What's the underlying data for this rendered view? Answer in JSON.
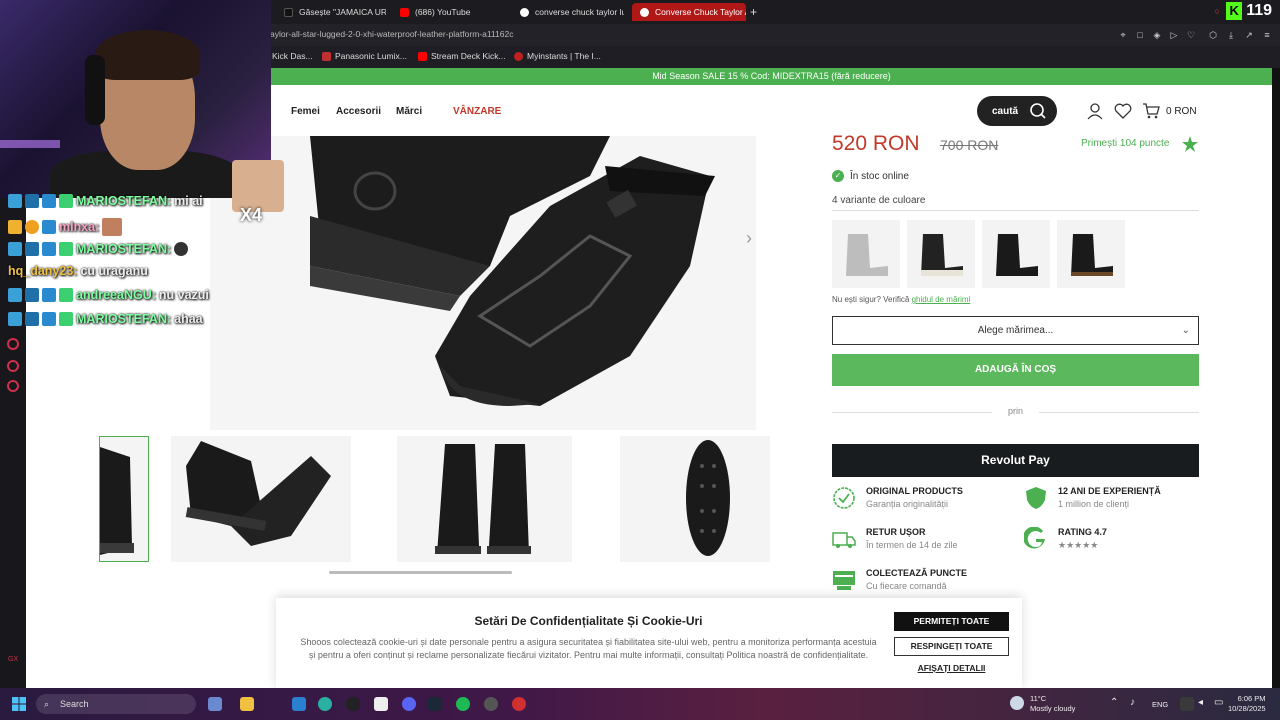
{
  "browser": {
    "tabs": [
      {
        "label": "Găsește \"JAMAICA URAG",
        "color": "#111111"
      },
      {
        "label": "(686) YouTube",
        "color": "#ff0000"
      },
      {
        "label": "converse chuck taylor lug",
        "color": "#ffffff"
      },
      {
        "label": "Converse Chuck Taylor A",
        "color": "#ffffff"
      }
    ],
    "url": "aylor-all-star-lugged-2-0-xhi-waterproof-leather-platform-a11162c",
    "bookmarks": [
      "Kick Das...",
      "Panasonic Lumix...",
      "Stream Deck Kick...",
      "Myinstants | The I..."
    ],
    "kick_viewers": "119"
  },
  "stream_chat": [
    {
      "user": "MARIOSTEFAN:",
      "text": "mi ai"
    },
    {
      "user": "mlnxa:",
      "text": ""
    },
    {
      "user": "MARIOSTEFAN:",
      "text": ""
    },
    {
      "user": "hq_dany23:",
      "text": "cu uraganu"
    },
    {
      "user": "andreeaNGU:",
      "text": "nu vazui"
    },
    {
      "user": "MARIOSTEFAN:",
      "text": "ahaa"
    }
  ],
  "emote_count": "X4",
  "site": {
    "promo": "Mid Season SALE 15 % Cod: MIDEXTRA15 (fără reducere)",
    "nav": [
      "Femei",
      "Accesorii",
      "Mărci",
      "VÂNZARE"
    ],
    "search_label": "caută",
    "cart_total": "0 RON"
  },
  "product": {
    "price": "520 RON",
    "old_price": "700 RON",
    "points": "Primești 104 puncte",
    "stock": "În stoc online",
    "variants_label": "4 variante de culoare",
    "size_guide_prefix": "Nu ești sigur? Verifică",
    "size_guide_link": "ghidul de mărimi",
    "size_select": "Alege mărimea...",
    "add_to_cart": "ADAUGĂ ÎN COȘ",
    "prin": "prin",
    "revolut": "Revolut Pay",
    "features": [
      {
        "title": "ORIGINAL PRODUCTS",
        "subtitle": "Garanția originalității",
        "icon": "check-badge-icon"
      },
      {
        "title": "12 ANI DE EXPERIENȚĂ",
        "subtitle": "1 million de clienți",
        "icon": "shield-icon"
      },
      {
        "title": "RETUR UȘOR",
        "subtitle": "În termen de 14 de zile",
        "icon": "truck-return-icon"
      },
      {
        "title": "RATING 4.7",
        "subtitle": "★★★★★",
        "icon": "google-g-icon"
      },
      {
        "title": "COLECTEAZĂ PUNCTE",
        "subtitle": "Cu fiecare comandă",
        "icon": "card-icon"
      }
    ]
  },
  "cookie": {
    "title": "Setări De Confidențialitate Și Cookie-Uri",
    "text": "Shooos colectează cookie-uri și date personale pentru a asigura securitatea și fiabilitatea site-ului web, pentru a monitoriza performanța acestuia și pentru a oferi conținut și reclame personalizate fiecărui vizitator. Pentru mai multe informații, consultați Politica noastră de confidențialitate.",
    "accept": "PERMITEȚI TOATE",
    "reject": "RESPINGEȚI TOATE",
    "details": "AFIȘAȚI DETALII"
  },
  "taskbar": {
    "search": "Search",
    "temp": "11°C",
    "weather": "Mostly cloudy",
    "lang": "ENG",
    "time": "6:06 PM",
    "date": "10/28/2025"
  },
  "colors": {
    "accent_green": "#4caf50",
    "price_red": "#c0392b",
    "tab_active": "#b01818",
    "kick_green": "#53fc18"
  }
}
